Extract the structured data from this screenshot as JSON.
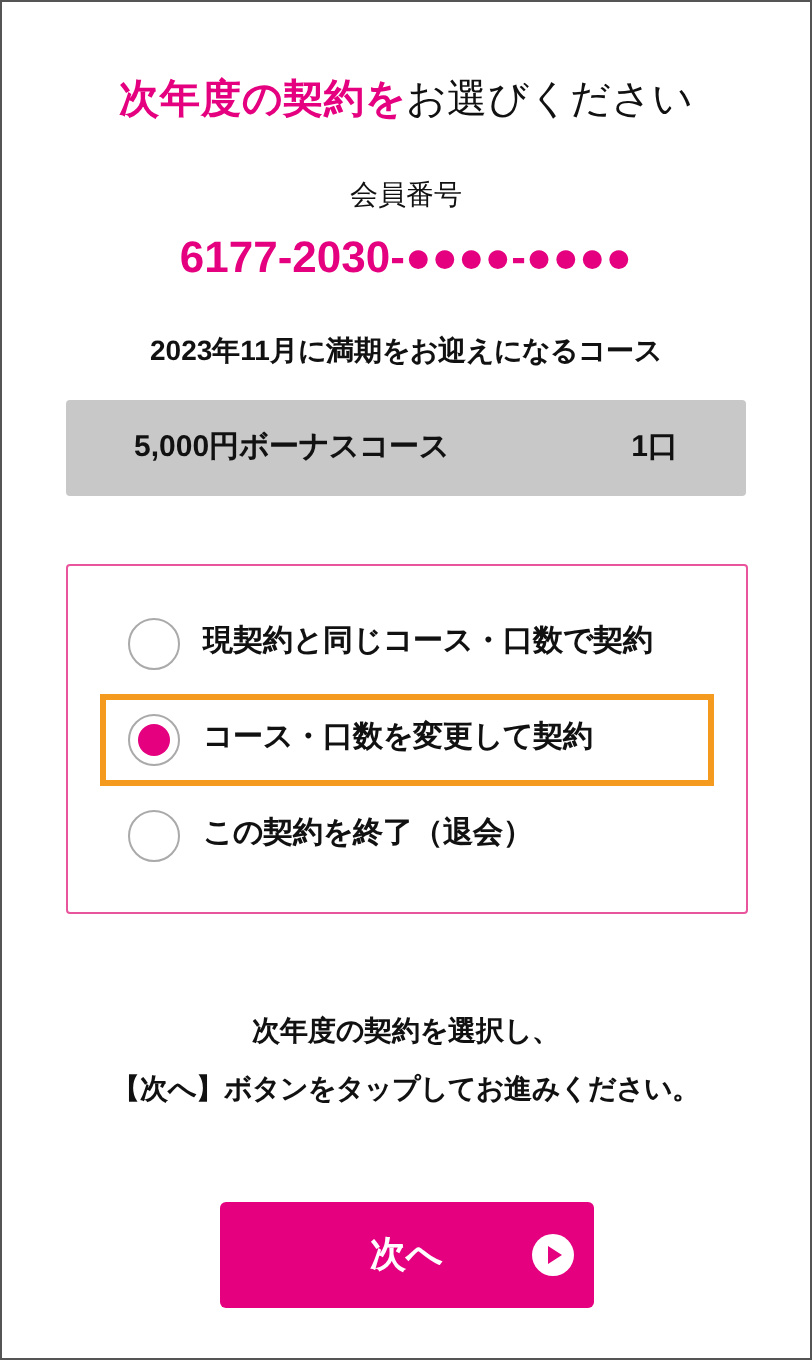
{
  "title": {
    "highlight": "次年度の契約を",
    "rest": "お選びください"
  },
  "member": {
    "label": "会員番号",
    "number": "6177-2030-●●●●-●●●●"
  },
  "expiry_heading": "2023年11月に満期をお迎えになるコース",
  "course": {
    "name": "5,000円ボーナスコース",
    "units": "1口"
  },
  "options": [
    {
      "label": "現契約と同じコース・口数で契約",
      "selected": false
    },
    {
      "label": "コース・口数を変更して契約",
      "selected": true
    },
    {
      "label": "この契約を終了（退会）",
      "selected": false
    }
  ],
  "instructions": [
    "次年度の契約を選択し、",
    "【次へ】ボタンをタップしてお進みください。"
  ],
  "next_button": {
    "label": "次へ"
  }
}
